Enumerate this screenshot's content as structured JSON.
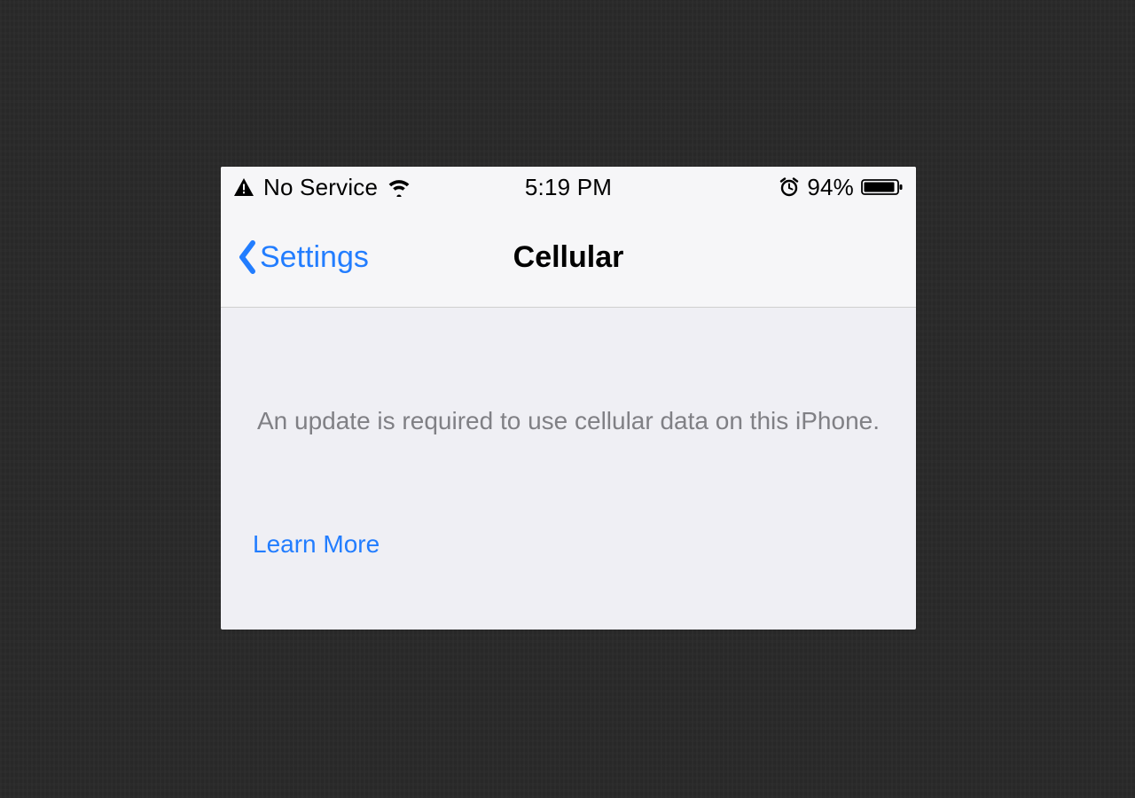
{
  "status_bar": {
    "carrier_text": "No Service",
    "time": "5:19 PM",
    "battery_percent": "94%",
    "icons": {
      "warning": "warning-triangle-icon",
      "wifi": "wifi-icon",
      "alarm": "alarm-clock-icon",
      "battery": "battery-icon"
    }
  },
  "nav": {
    "back_label": "Settings",
    "title": "Cellular"
  },
  "content": {
    "message": "An update is required to use cellular data on this iPhone.",
    "learn_more_label": "Learn More"
  },
  "colors": {
    "accent": "#227dff",
    "muted_text": "#808085",
    "header_bg": "#f6f6f8",
    "content_bg": "#efeff4",
    "page_bg": "#2a2a2a"
  }
}
